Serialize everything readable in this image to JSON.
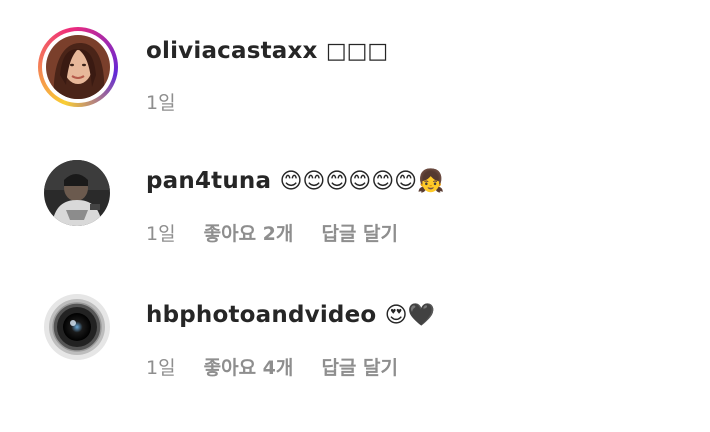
{
  "comments": [
    {
      "username": "oliviacastaxx",
      "emoji": "□□□",
      "time": "1일",
      "has_story_ring": true
    },
    {
      "username": "pan4tuna",
      "emoji": "😊😊😊😊😊😊👧",
      "time": "1일",
      "likes": "좋아요 2개",
      "reply": "답글 달기",
      "has_story_ring": false
    },
    {
      "username": "hbphotoandvideo",
      "emoji": "😍🖤",
      "time": "1일",
      "likes": "좋아요 4개",
      "reply": "답글 달기",
      "has_story_ring": false
    }
  ],
  "colors": {
    "text_primary": "#262626",
    "text_secondary": "#8e8e8e",
    "story_ring_start": "#f9ce34",
    "story_ring_mid": "#ee2a7b",
    "story_ring_end": "#6228d7"
  }
}
